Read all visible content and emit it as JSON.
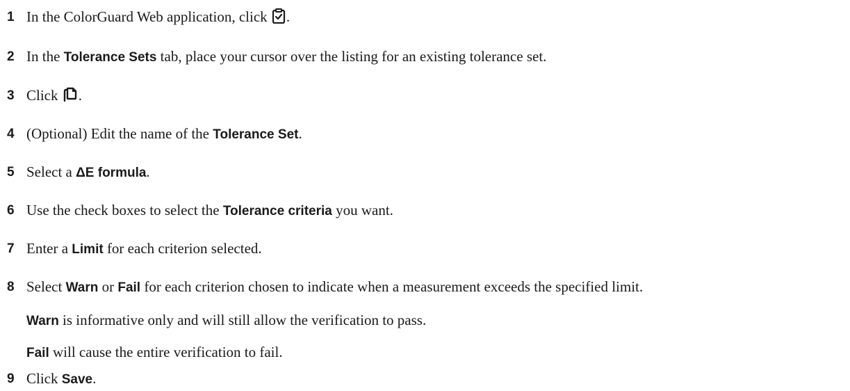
{
  "steps": [
    {
      "number": "1",
      "parts": [
        "In the ColorGuard Web application, click ",
        "."
      ],
      "icon": "clipboard-check-icon"
    },
    {
      "number": "2",
      "pre": "In the ",
      "bold": "Tolerance Sets",
      "post": " tab, place your cursor over the listing for an existing tolerance set."
    },
    {
      "number": "3",
      "parts": [
        "Click ",
        "."
      ],
      "icon": "duplicate-icon"
    },
    {
      "number": "4",
      "pre": "(Optional) Edit the name of the ",
      "bold": "Tolerance Set",
      "post": "."
    },
    {
      "number": "5",
      "pre": "Select a ",
      "bold": "ΔE formula",
      "post": "."
    },
    {
      "number": "6",
      "pre": "Use the check boxes to select the ",
      "bold": "Tolerance criteria",
      "post": " you want."
    },
    {
      "number": "7",
      "pre": "Enter a ",
      "bold": "Limit",
      "post": " for each criterion selected."
    },
    {
      "number": "8",
      "pre": "Select ",
      "bold": "Warn",
      "mid": " or ",
      "bold2": "Fail",
      "post": " for each criterion chosen to indicate when a measurement exceeds the specified limit."
    },
    {
      "number": "9",
      "pre": "Click ",
      "bold": "Save",
      "post": "."
    }
  ],
  "notes": [
    {
      "bold": "Warn",
      "post": " is informative only and will still allow the verification to pass."
    },
    {
      "bold": "Fail",
      "post": " will cause the entire verification to fail."
    }
  ]
}
